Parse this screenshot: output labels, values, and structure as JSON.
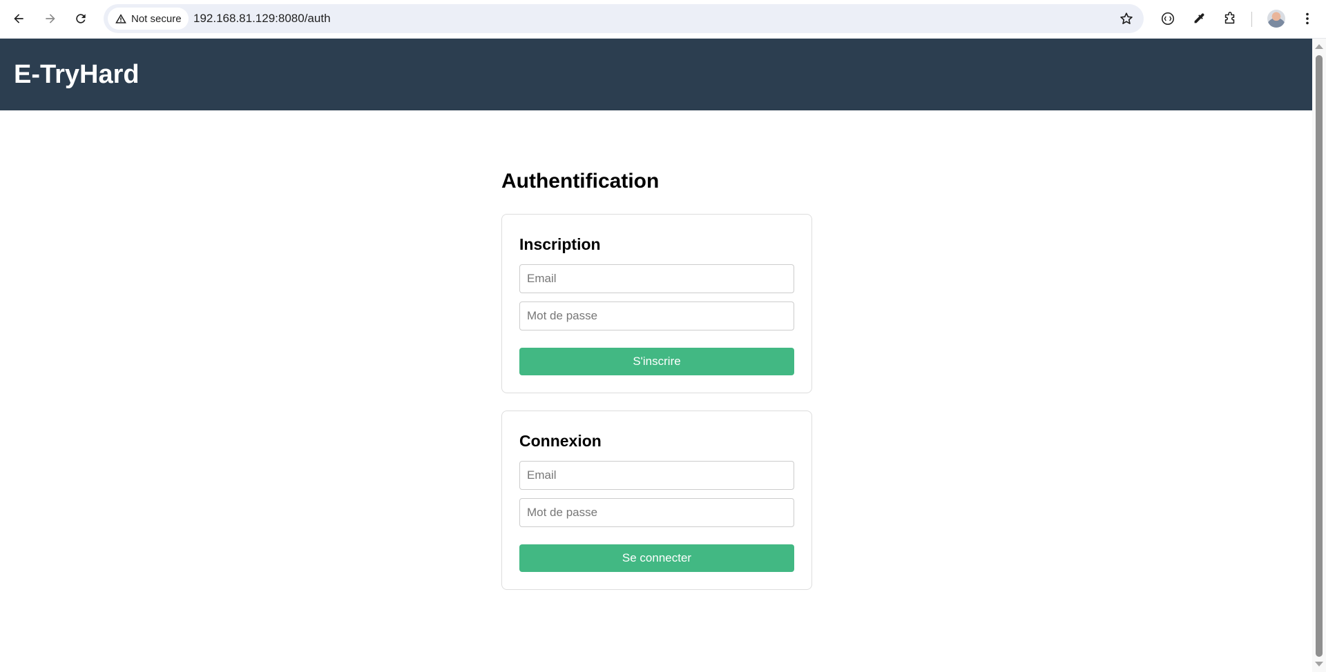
{
  "browser": {
    "security_label": "Not secure",
    "url": "192.168.81.129:8080/auth"
  },
  "site": {
    "title": "E-TryHard"
  },
  "page": {
    "heading": "Authentification"
  },
  "signup": {
    "title": "Inscription",
    "email_placeholder": "Email",
    "password_placeholder": "Mot de passe",
    "button_label": "S'inscrire"
  },
  "login": {
    "title": "Connexion",
    "email_placeholder": "Email",
    "password_placeholder": "Mot de passe",
    "button_label": "Se connecter"
  },
  "colors": {
    "header_bg": "#2c3e50",
    "button_bg": "#42b883",
    "card_border": "#dddddd"
  },
  "icons": [
    "back-icon",
    "forward-icon",
    "reload-icon",
    "warning-icon",
    "star-icon",
    "extension-icon",
    "eyedropper-icon",
    "puzzle-icon",
    "more-icon"
  ]
}
